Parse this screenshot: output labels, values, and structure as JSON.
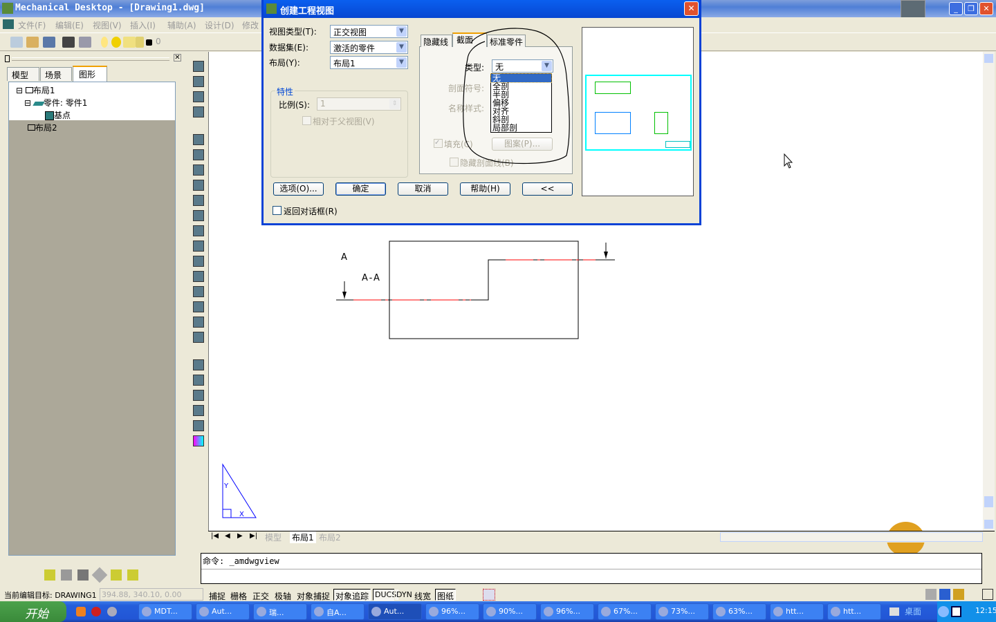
{
  "app": {
    "title": "Mechanical Desktop - [Drawing1.dwg]"
  },
  "menu": [
    "文件(F)",
    "编辑(E)",
    "视图(V)",
    "插入(I)",
    "辅助(A)",
    "设计(D)",
    "修改"
  ],
  "toolbar": {
    "layer_value": "0"
  },
  "left_panel": {
    "tabs": [
      "模型",
      "场景",
      "图形"
    ],
    "active_tab": "图形",
    "tree": [
      {
        "label": "布局1",
        "expanded": true
      },
      {
        "label": "零件: 零件1",
        "expanded": true
      },
      {
        "label": "基点"
      },
      {
        "label": "布局2"
      }
    ]
  },
  "drawing": {
    "section_label": "A",
    "view_label": "A-A",
    "line_color": "#ff0000",
    "ucs_color": "#0000ff"
  },
  "layout_tabs": [
    "模型",
    "布局1",
    "布局2"
  ],
  "active_layout": "布局1",
  "command": {
    "text": "命令:  _amdwgview"
  },
  "status": {
    "target_label": "当前编辑目标: DRAWING1",
    "coords": "394.88, 340.10, 0.00",
    "buttons": [
      {
        "label": "捕捉",
        "on": false
      },
      {
        "label": "栅格",
        "on": false
      },
      {
        "label": "正交",
        "on": false
      },
      {
        "label": "极轴",
        "on": false
      },
      {
        "label": "对象捕捉",
        "on": false
      },
      {
        "label": "对象追踪",
        "on": true
      },
      {
        "label": "DUCS",
        "on": true
      },
      {
        "label": "DYN",
        "on": false
      },
      {
        "label": "线宽",
        "on": false
      },
      {
        "label": "图纸",
        "on": true
      }
    ]
  },
  "dialog": {
    "title": "创建工程视图",
    "view_type_label": "视图类型(T):",
    "view_type_value": "正交视图",
    "dataset_label": "数据集(E):",
    "dataset_value": "激活的零件",
    "layout_label": "布局(Y):",
    "layout_value": "布局1",
    "properties_title": "特性",
    "scale_label": "比例(S):",
    "scale_value": "1",
    "relative_parent_label": "相对于父视图(V)",
    "tabs": [
      "隐藏线",
      "截面",
      "标准零件"
    ],
    "active_tab": "截面",
    "type_label": "类型:",
    "type_value": "无",
    "type_options": [
      "无",
      "全剖",
      "半剖",
      "偏移",
      "对齐",
      "斜剖",
      "局部剖"
    ],
    "section_symbol_label": "剖面符号:",
    "name_style_label": "名称样式:",
    "fill_label": "填充(C)",
    "fill_checked": true,
    "pattern_button": "图案(P)...",
    "hide_hatch_label": "隐藏剖面线(B)",
    "options_button": "选项(O)...",
    "ok_button": "确定",
    "cancel_button": "取消",
    "help_button": "帮助(H)",
    "collapse_button": "<<",
    "return_label": "返回对话框(R)",
    "return_checked": false
  },
  "taskbar": {
    "start": "开始",
    "tasks": [
      "MDT...",
      "Aut...",
      "瑞...",
      "自A...",
      "Aut...",
      "96%...",
      "90%...",
      "96%...",
      "67%...",
      "73%...",
      "63%...",
      "htt...",
      "htt..."
    ],
    "active_task_index": 4,
    "desktop_label": "桌面",
    "clock": "12:15"
  }
}
